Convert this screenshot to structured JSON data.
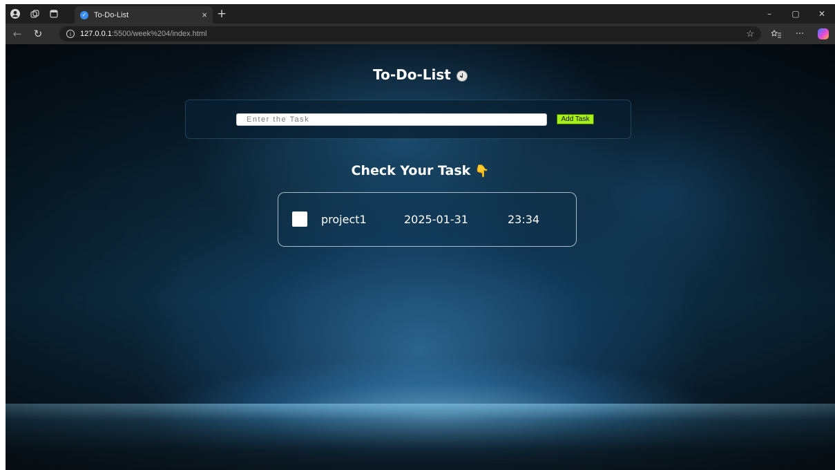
{
  "browser": {
    "tab_title": "To-Do-List",
    "url_host": "127.0.0.1",
    "url_path": ":5500/week%204/index.html",
    "icons": {
      "profile": "profile-icon",
      "workspaces": "workspaces-icon",
      "tab_actions": "tab-actions-icon",
      "tab_close": "×",
      "new_tab": "+",
      "back": "←",
      "reload": "↻",
      "favorite": "☆",
      "collections": "collections-icon",
      "more": "···"
    },
    "window_controls": {
      "minimize": "–",
      "restore": "▢",
      "close": "✕"
    }
  },
  "page": {
    "title": "To-Do-List",
    "input": {
      "placeholder": "Enter the Task",
      "value": ""
    },
    "add_button_label": "Add Task",
    "section_title": "Check Your Task",
    "tasks": [
      {
        "name": "project1",
        "date": "2025-01-31",
        "time": "23:34",
        "checked": false
      }
    ]
  },
  "colors": {
    "add_button": "#a6f01a",
    "text": "#ffffff",
    "accent_pointer": "#f3b52a"
  }
}
